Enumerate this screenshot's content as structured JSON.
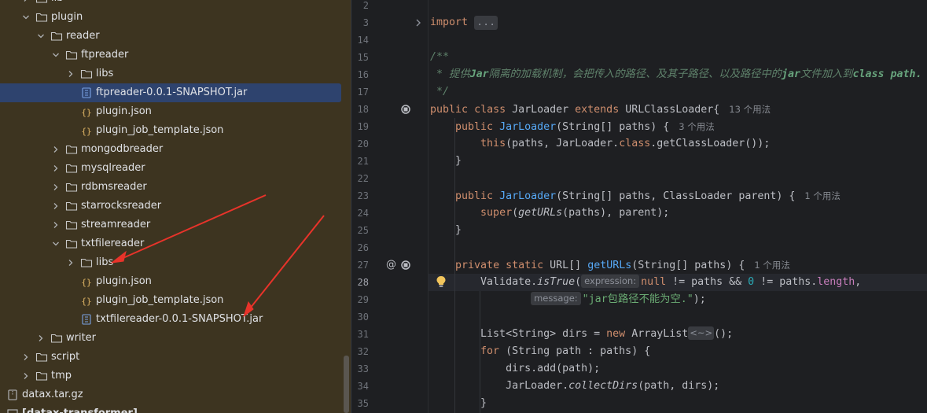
{
  "tree": {
    "rows": [
      {
        "label": "lib",
        "kind": "folder",
        "depth": 1,
        "expanded": false
      },
      {
        "label": "plugin",
        "kind": "folder",
        "depth": 1,
        "expanded": true
      },
      {
        "label": "reader",
        "kind": "folder",
        "depth": 2,
        "expanded": true
      },
      {
        "label": "ftpreader",
        "kind": "folder",
        "depth": 3,
        "expanded": true
      },
      {
        "label": "libs",
        "kind": "folder",
        "depth": 4,
        "expanded": false
      },
      {
        "label": "ftpreader-0.0.1-SNAPSHOT.jar",
        "kind": "jar",
        "depth": 4,
        "selected": true
      },
      {
        "label": "plugin.json",
        "kind": "json",
        "depth": 4
      },
      {
        "label": "plugin_job_template.json",
        "kind": "json",
        "depth": 4
      },
      {
        "label": "mongodbreader",
        "kind": "folder",
        "depth": 3,
        "expanded": false
      },
      {
        "label": "mysqlreader",
        "kind": "folder",
        "depth": 3,
        "expanded": false
      },
      {
        "label": "rdbmsreader",
        "kind": "folder",
        "depth": 3,
        "expanded": false
      },
      {
        "label": "starrocksreader",
        "kind": "folder",
        "depth": 3,
        "expanded": false
      },
      {
        "label": "streamreader",
        "kind": "folder",
        "depth": 3,
        "expanded": false
      },
      {
        "label": "txtfilereader",
        "kind": "folder",
        "depth": 3,
        "expanded": true
      },
      {
        "label": "libs",
        "kind": "folder",
        "depth": 4,
        "expanded": false
      },
      {
        "label": "plugin.json",
        "kind": "json",
        "depth": 4
      },
      {
        "label": "plugin_job_template.json",
        "kind": "json",
        "depth": 4
      },
      {
        "label": "txtfilereader-0.0.1-SNAPSHOT.jar",
        "kind": "jar",
        "depth": 4
      },
      {
        "label": "writer",
        "kind": "folder",
        "depth": 2,
        "expanded": false
      },
      {
        "label": "script",
        "kind": "folder",
        "depth": 1,
        "expanded": false
      },
      {
        "label": "tmp",
        "kind": "folder",
        "depth": 1,
        "expanded": false
      },
      {
        "label": "datax.tar.gz",
        "kind": "archive",
        "depth": 0
      },
      {
        "label": "[datax-transformer]",
        "kind": "module",
        "depth": 0
      }
    ]
  },
  "editor": {
    "current_line": "28",
    "lines": [
      {
        "n": "2",
        "code": ""
      },
      {
        "n": "3",
        "code": "import ...",
        "fold": true
      },
      {
        "n": "14",
        "code": ""
      },
      {
        "n": "15",
        "code": "/**"
      },
      {
        "n": "16",
        "code": " * 提供Jar隔离的加载机制，会把传入的路径、及其子路径、以及路径中的jar文件加入到class path."
      },
      {
        "n": "17",
        "code": " */"
      },
      {
        "n": "18",
        "code": "public class JarLoader extends URLClassLoader{",
        "hint": "13 个用法"
      },
      {
        "n": "19",
        "code": "    public JarLoader(String[] paths) {",
        "hint": "3 个用法"
      },
      {
        "n": "20",
        "code": "        this(paths, JarLoader.class.getClassLoader());"
      },
      {
        "n": "21",
        "code": "    }"
      },
      {
        "n": "22",
        "code": ""
      },
      {
        "n": "23",
        "code": "    public JarLoader(String[] paths, ClassLoader parent) {",
        "hint": "1 个用法"
      },
      {
        "n": "24",
        "code": "        super(getURLs(paths), parent);"
      },
      {
        "n": "25",
        "code": "    }"
      },
      {
        "n": "26",
        "code": ""
      },
      {
        "n": "27",
        "code": "    private static URL[] getURLs(String[] paths) {",
        "hint": "1 个用法"
      },
      {
        "n": "28",
        "code": "        Validate.isTrue(expression: null != paths && 0 != paths.length,"
      },
      {
        "n": "29",
        "code": "                message: \"jar包路径不能为空.\");"
      },
      {
        "n": "30",
        "code": ""
      },
      {
        "n": "31",
        "code": "        List<String> dirs = new ArrayList<~>();"
      },
      {
        "n": "32",
        "code": "        for (String path : paths) {"
      },
      {
        "n": "33",
        "code": "            dirs.add(path);"
      },
      {
        "n": "34",
        "code": "            JarLoader.collectDirs(path, dirs);"
      },
      {
        "n": "35",
        "code": "        }"
      }
    ],
    "inlay_expression": "expression:",
    "inlay_message": "message:",
    "fold_text": "...",
    "diamond_text": "<~>"
  },
  "colors": {
    "tree_bg": "#3d3420",
    "selection": "#2e436e",
    "editor_bg": "#1e1f22",
    "annotation_arrow": "#e8332a"
  }
}
